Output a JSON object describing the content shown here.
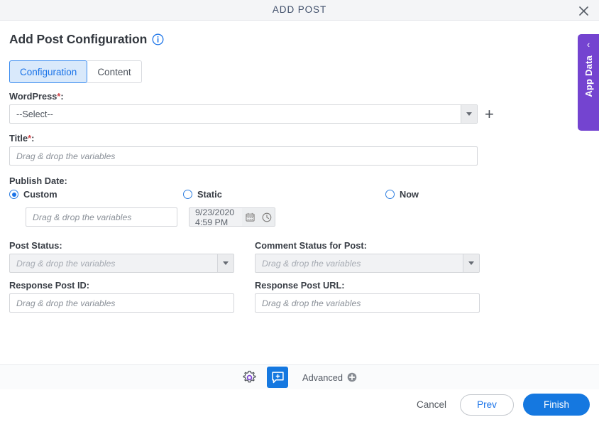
{
  "window": {
    "title": "ADD POST",
    "close_icon": "close-icon"
  },
  "heading": {
    "title": "Add Post Configuration",
    "info_icon": "info-circle-icon"
  },
  "tabs": [
    {
      "label": "Configuration",
      "active": true
    },
    {
      "label": "Content",
      "active": false
    }
  ],
  "form": {
    "wordpress": {
      "label": "WordPress",
      "required": "*",
      "value": "--Select--",
      "add_icon": "plus-icon"
    },
    "title": {
      "label": "Title",
      "required": "*",
      "placeholder": "Drag & drop the variables"
    },
    "publish_date": {
      "label": "Publish Date:",
      "options": [
        {
          "label": "Custom",
          "selected": true
        },
        {
          "label": "Static",
          "selected": false
        },
        {
          "label": "Now",
          "selected": false
        }
      ],
      "custom_placeholder": "Drag & drop the variables",
      "static_value": "9/23/2020 4:59 PM",
      "calendar_icon": "calendar-icon",
      "clock_icon": "clock-icon"
    },
    "post_status": {
      "label": "Post Status:",
      "placeholder": "Drag & drop the variables"
    },
    "comment_status": {
      "label": "Comment Status for Post:",
      "placeholder": "Drag & drop the variables"
    },
    "response_post_id": {
      "label": "Response Post ID:",
      "placeholder": "Drag & drop the variables"
    },
    "response_post_url": {
      "label": "Response Post URL:",
      "placeholder": "Drag & drop the variables"
    }
  },
  "toolbar": {
    "settings_icon": "gear-icon",
    "comment_icon": "add-comment-icon",
    "advanced_label": "Advanced",
    "advanced_icon": "plus-circle-icon"
  },
  "actions": {
    "cancel": "Cancel",
    "prev": "Prev",
    "finish": "Finish"
  },
  "app_data_tab": {
    "label": "App Data",
    "chevron": "‹"
  },
  "colors": {
    "accent_blue": "#1578e0",
    "tab_active_bg": "#d9e9fb",
    "purple": "#7444d0",
    "required_red": "#d0444a"
  }
}
